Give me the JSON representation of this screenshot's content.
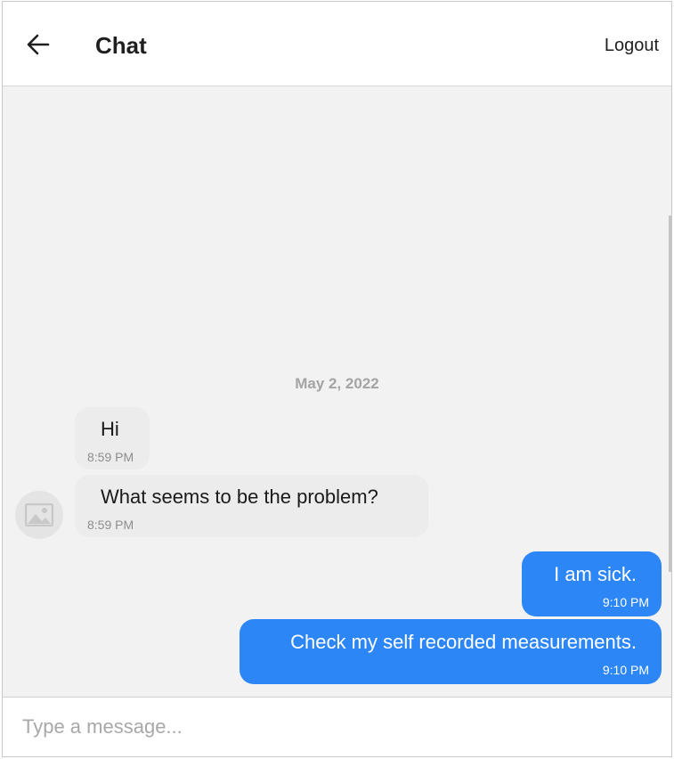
{
  "header": {
    "title": "Chat",
    "logout_label": "Logout"
  },
  "conversation": {
    "date_separator": "May 2, 2022",
    "messages": [
      {
        "direction": "in",
        "text": "Hi",
        "time": "8:59 PM"
      },
      {
        "direction": "in",
        "text": "What seems to be the problem?",
        "time": "8:59 PM"
      },
      {
        "direction": "out",
        "text": "I am sick.",
        "time": "9:10 PM"
      },
      {
        "direction": "out",
        "text": "Check my self recorded measurements.",
        "time": "9:10 PM"
      }
    ]
  },
  "composer": {
    "placeholder": "Type a message..."
  },
  "colors": {
    "outgoing_bubble": "#2d86f6",
    "incoming_bubble": "#ececec",
    "chat_background": "#f2f2f2"
  },
  "icons": {
    "back": "arrow-left-icon",
    "avatar_placeholder": "image-placeholder-icon"
  }
}
